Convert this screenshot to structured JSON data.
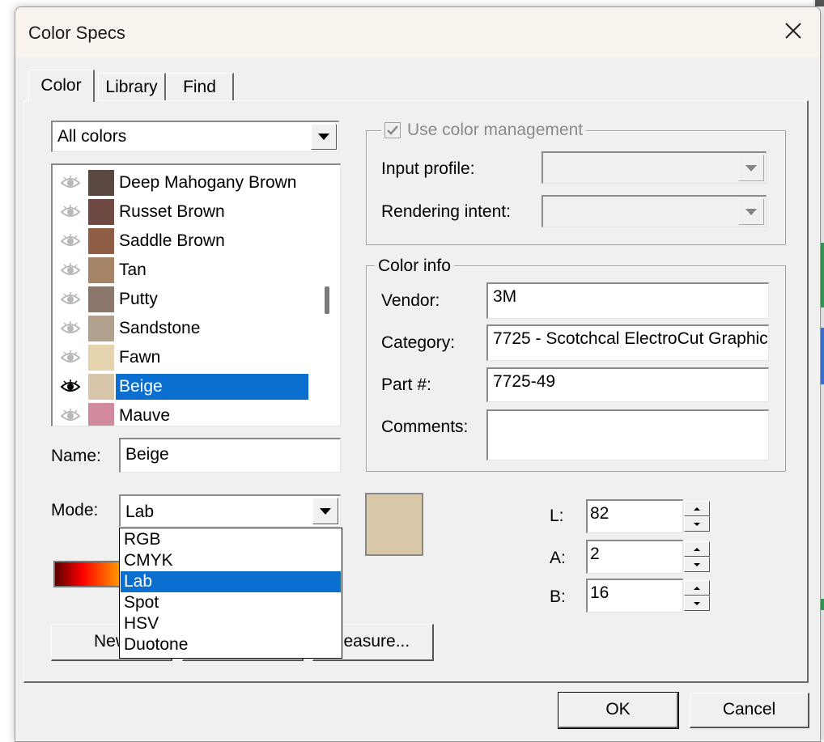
{
  "window": {
    "title": "Color Specs"
  },
  "tabs": [
    {
      "label": "Color",
      "active": true
    },
    {
      "label": "Library",
      "active": false
    },
    {
      "label": "Find",
      "active": false
    }
  ],
  "filter": {
    "value": "All colors"
  },
  "color_list": [
    {
      "name": "Deep Mahogany Brown",
      "swatch": "#5b4742",
      "selected": false
    },
    {
      "name": "Russet Brown",
      "swatch": "#6f4a43",
      "selected": false
    },
    {
      "name": "Saddle Brown",
      "swatch": "#8d5e44",
      "selected": false
    },
    {
      "name": "Tan",
      "swatch": "#a58365",
      "selected": false
    },
    {
      "name": "Putty",
      "swatch": "#8b766b",
      "selected": false
    },
    {
      "name": "Sandstone",
      "swatch": "#b2a18e",
      "selected": false
    },
    {
      "name": "Fawn",
      "swatch": "#e5d3ae",
      "selected": false
    },
    {
      "name": "Beige",
      "swatch": "#d9c6aa",
      "selected": true
    },
    {
      "name": "Mauve",
      "swatch": "#d08a9b",
      "selected": false
    }
  ],
  "name_field": {
    "label": "Name:",
    "value": "Beige"
  },
  "mode": {
    "label": "Mode:",
    "value": "Lab",
    "options": [
      "RGB",
      "CMYK",
      "Lab",
      "Spot",
      "HSV",
      "Duotone"
    ],
    "selected_index": 2
  },
  "color_management": {
    "checkbox_label": "Use color management",
    "checked": true,
    "enabled": false,
    "input_profile_label": "Input profile:",
    "rendering_intent_label": "Rendering intent:"
  },
  "color_info": {
    "group_label": "Color info",
    "vendor_label": "Vendor:",
    "vendor": "3M",
    "category_label": "Category:",
    "category": "7725 - Scotchcal ElectroCut Graphic",
    "part_label": "Part #:",
    "part": "7725-49",
    "comments_label": "Comments:",
    "comments": ""
  },
  "preview_color": "#dac8aa",
  "lab": {
    "l_label": "L:",
    "l": "82",
    "a_label": "A:",
    "a": "2",
    "b_label": "B:",
    "b": "16"
  },
  "buttons": {
    "new_partial": "New",
    "measure_partial": "Measure...",
    "ok": "OK",
    "cancel": "Cancel"
  },
  "colors": {
    "accent": "#0a6ed1",
    "dialog_bg": "#f0f0f0",
    "titlebar_bg": "#f8f3ec"
  }
}
